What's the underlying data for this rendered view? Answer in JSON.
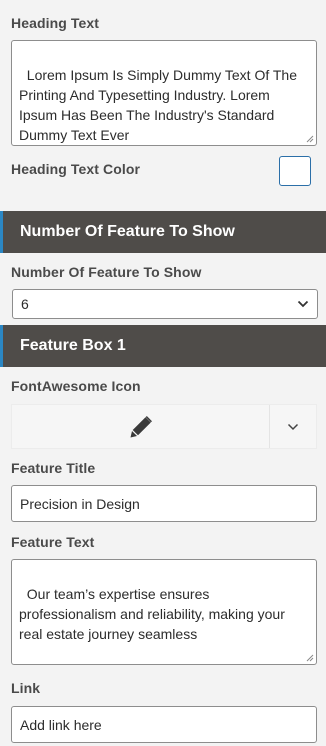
{
  "heading_text": {
    "label": "Heading Text",
    "value": "Lorem Ipsum Is Simply Dummy Text Of The Printing And Typesetting Industry. Lorem Ipsum Has Been The Industry's Standard Dummy Text Ever"
  },
  "heading_text_color": {
    "label": "Heading Text Color",
    "value": "#ffffff"
  },
  "section_features_count": {
    "title": "Number Of Feature To Show",
    "field_label": "Number Of Feature To Show",
    "selected": "6"
  },
  "section_feature_box_1": {
    "title": "Feature Box 1"
  },
  "fontawesome_icon": {
    "label": "FontAwesome Icon",
    "icon": "pencil-icon"
  },
  "feature_title": {
    "label": "Feature Title",
    "value": "Precision in Design"
  },
  "feature_text": {
    "label": "Feature Text",
    "value": "Our team’s expertise ensures professionalism and reliability, making your real estate journey seamless"
  },
  "link": {
    "label": "Link",
    "placeholder": "Add link here"
  },
  "colors": {
    "section_bar": "#4f4c49",
    "accent": "#2b87c4",
    "background": "#f3f3f3"
  }
}
